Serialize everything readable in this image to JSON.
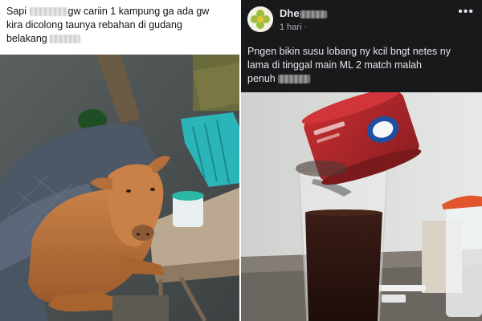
{
  "left_post": {
    "caption_line1_start": "Sapi",
    "caption_line1_end": "gw cariin 1 kampung ga ada gw",
    "caption_line2": "kira dicolong taunya rebahan di gudang",
    "caption_line3": "belakang"
  },
  "right_post": {
    "author": "Dhe",
    "time": "1 hari",
    "caption_line1": "Pngen bikin susu lobang ny kcil bngt netes ny",
    "caption_line2": "lama  di tinggal main ML 2 match  malah",
    "caption_line3": "penuh"
  },
  "colors": {
    "dark_bg": "#18191a",
    "dark_text": "#e4e6eb",
    "muted_text": "#b0b3b8",
    "can_red": "#b3262b",
    "chair_teal": "#2bb5b8",
    "calf_brown": "#b8713d"
  }
}
